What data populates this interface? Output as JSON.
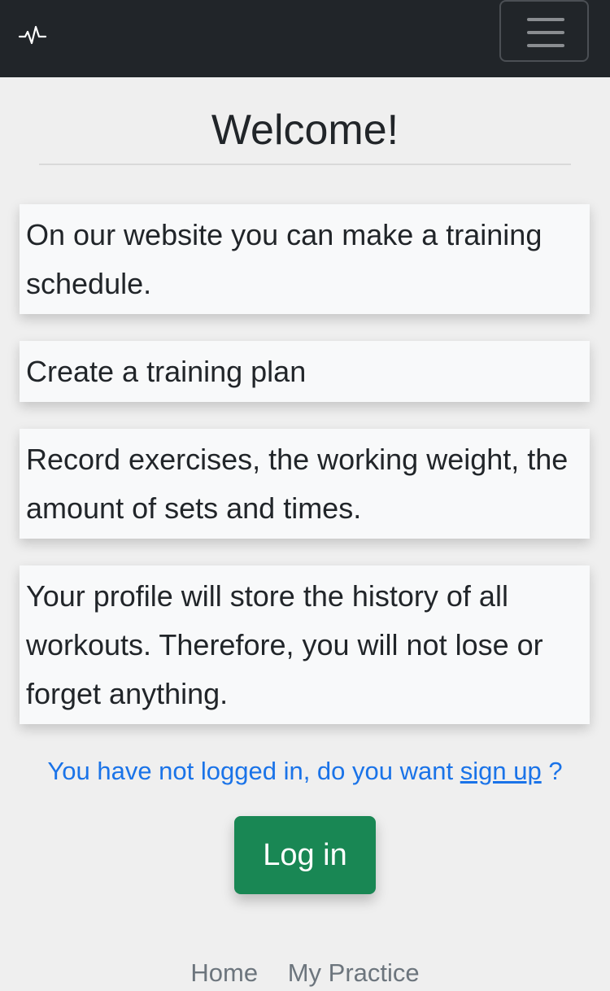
{
  "navbar": {
    "brand_icon": "pulse-icon",
    "menu_icon": "hamburger-menu-icon",
    "background": "#212529"
  },
  "main": {
    "title": "Welcome!",
    "cards": [
      {
        "text": "On our website you can make a training schedule."
      },
      {
        "text": "Create a training plan"
      },
      {
        "text": "Record exercises, the working weight, the amount of sets and times."
      },
      {
        "text": "Your profile will store the history of all workouts. Therefore, you will not lose or forget anything."
      }
    ]
  },
  "auth": {
    "message_prefix": "You have not logged in, do you want",
    "signup_link": "sign up",
    "message_suffix": "?",
    "login_button": "Log in",
    "link_color": "#1a73e8",
    "button_color": "#198754"
  },
  "footer": {
    "links": [
      {
        "label": "Home"
      },
      {
        "label": "My Practice"
      }
    ]
  }
}
